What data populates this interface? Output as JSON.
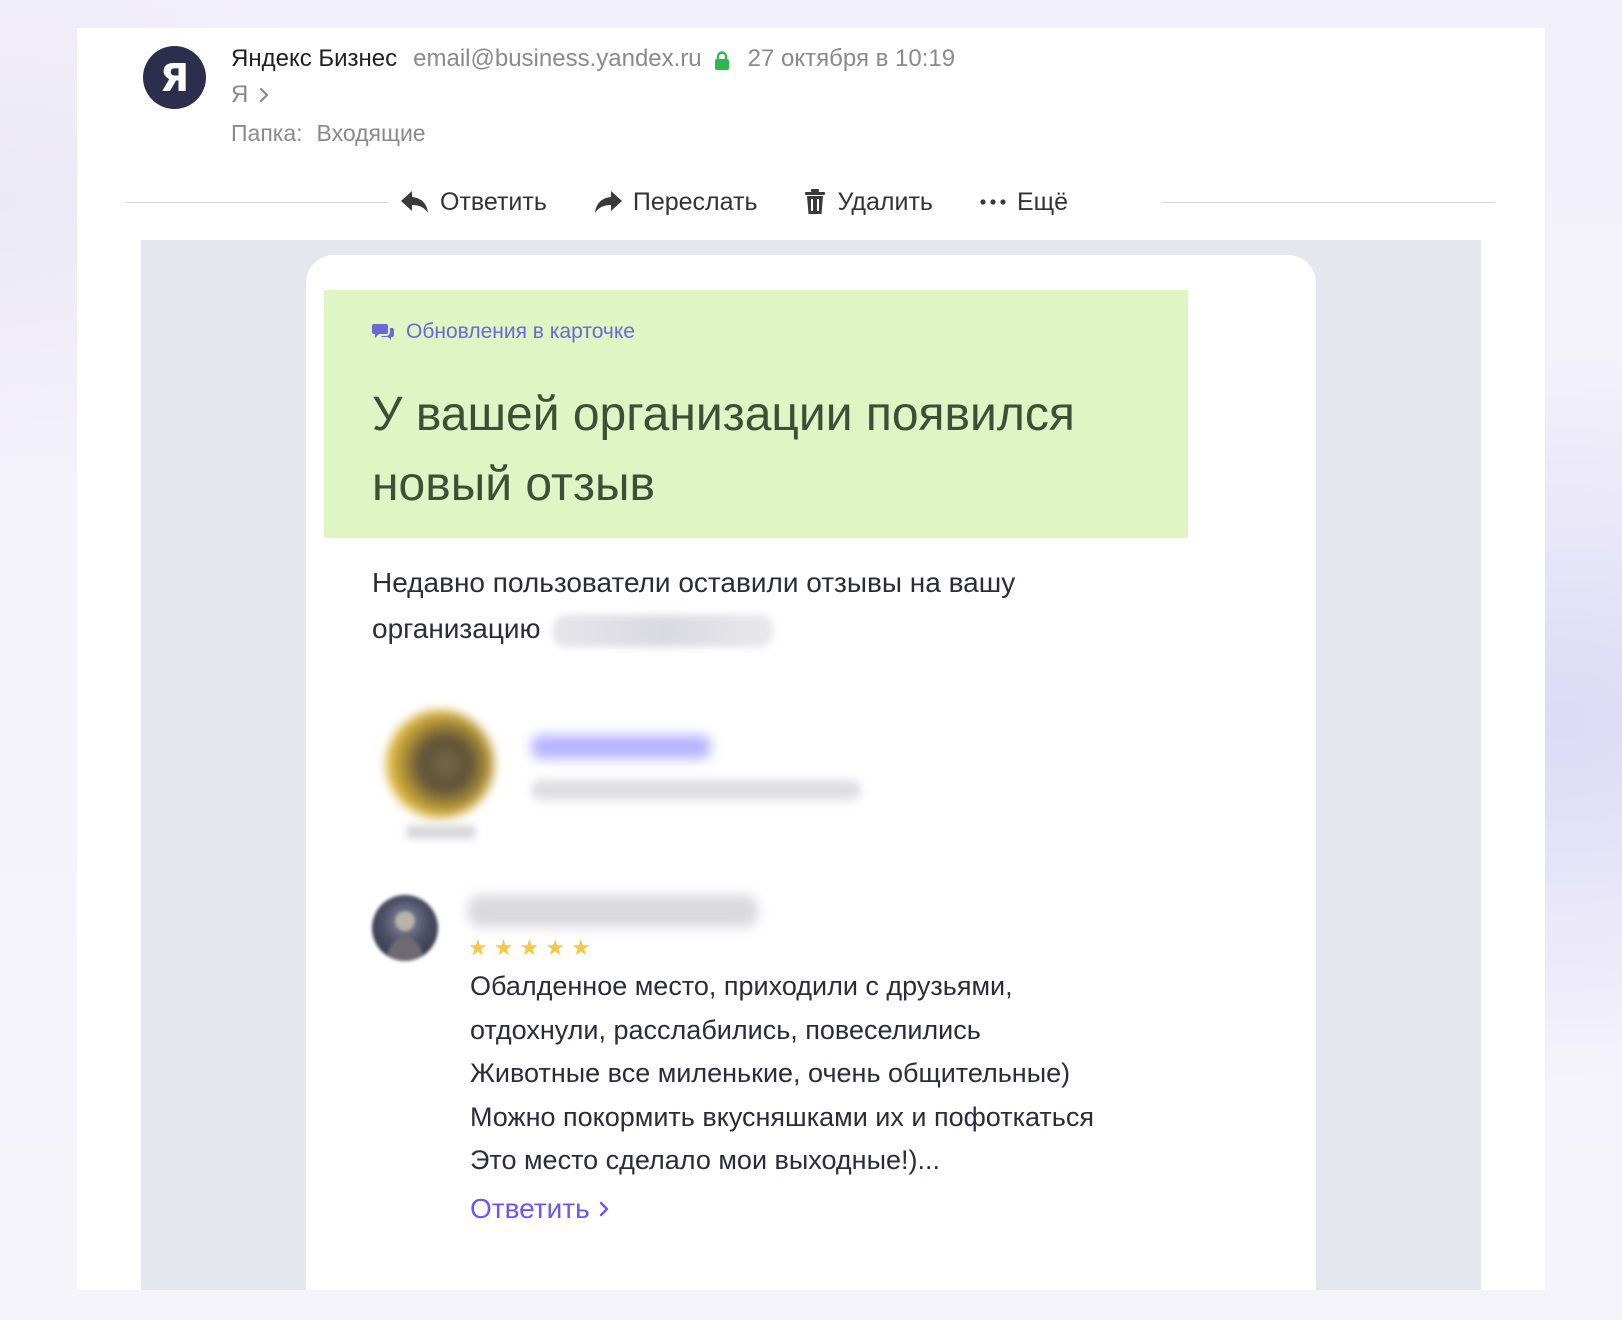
{
  "header": {
    "avatar_letter": "Я",
    "sender_name": "Яндекс Бизнес",
    "sender_email": "email@business.yandex.ru",
    "date": "27 октября в 10:19",
    "recipient": "Я",
    "folder_label": "Папка:",
    "folder_value": "Входящие"
  },
  "toolbar": {
    "reply_label": "Ответить",
    "forward_label": "Переслать",
    "delete_label": "Удалить",
    "more_label": "Ещё"
  },
  "message": {
    "tag": "Обновления в карточке",
    "title": "У вашей организации появился новый отзыв",
    "intro": "Недавно пользователи оставили отзывы на вашу организацию",
    "review": {
      "rating": 5,
      "text_lines": [
        "Обалденное место, приходили с друзьями,",
        "отдохнули, расслабились, повеселились",
        "Животные все миленькие, очень общительные)",
        "Можно покормить вкусняшками их и пофоткаться",
        "Это место сделало мои выходные!)..."
      ],
      "reply_label": "Ответить"
    }
  },
  "colors": {
    "accent": "#6a56ff",
    "hero_bg": "#dff5c4",
    "star": "#f6c845",
    "lock": "#2fb84d"
  }
}
